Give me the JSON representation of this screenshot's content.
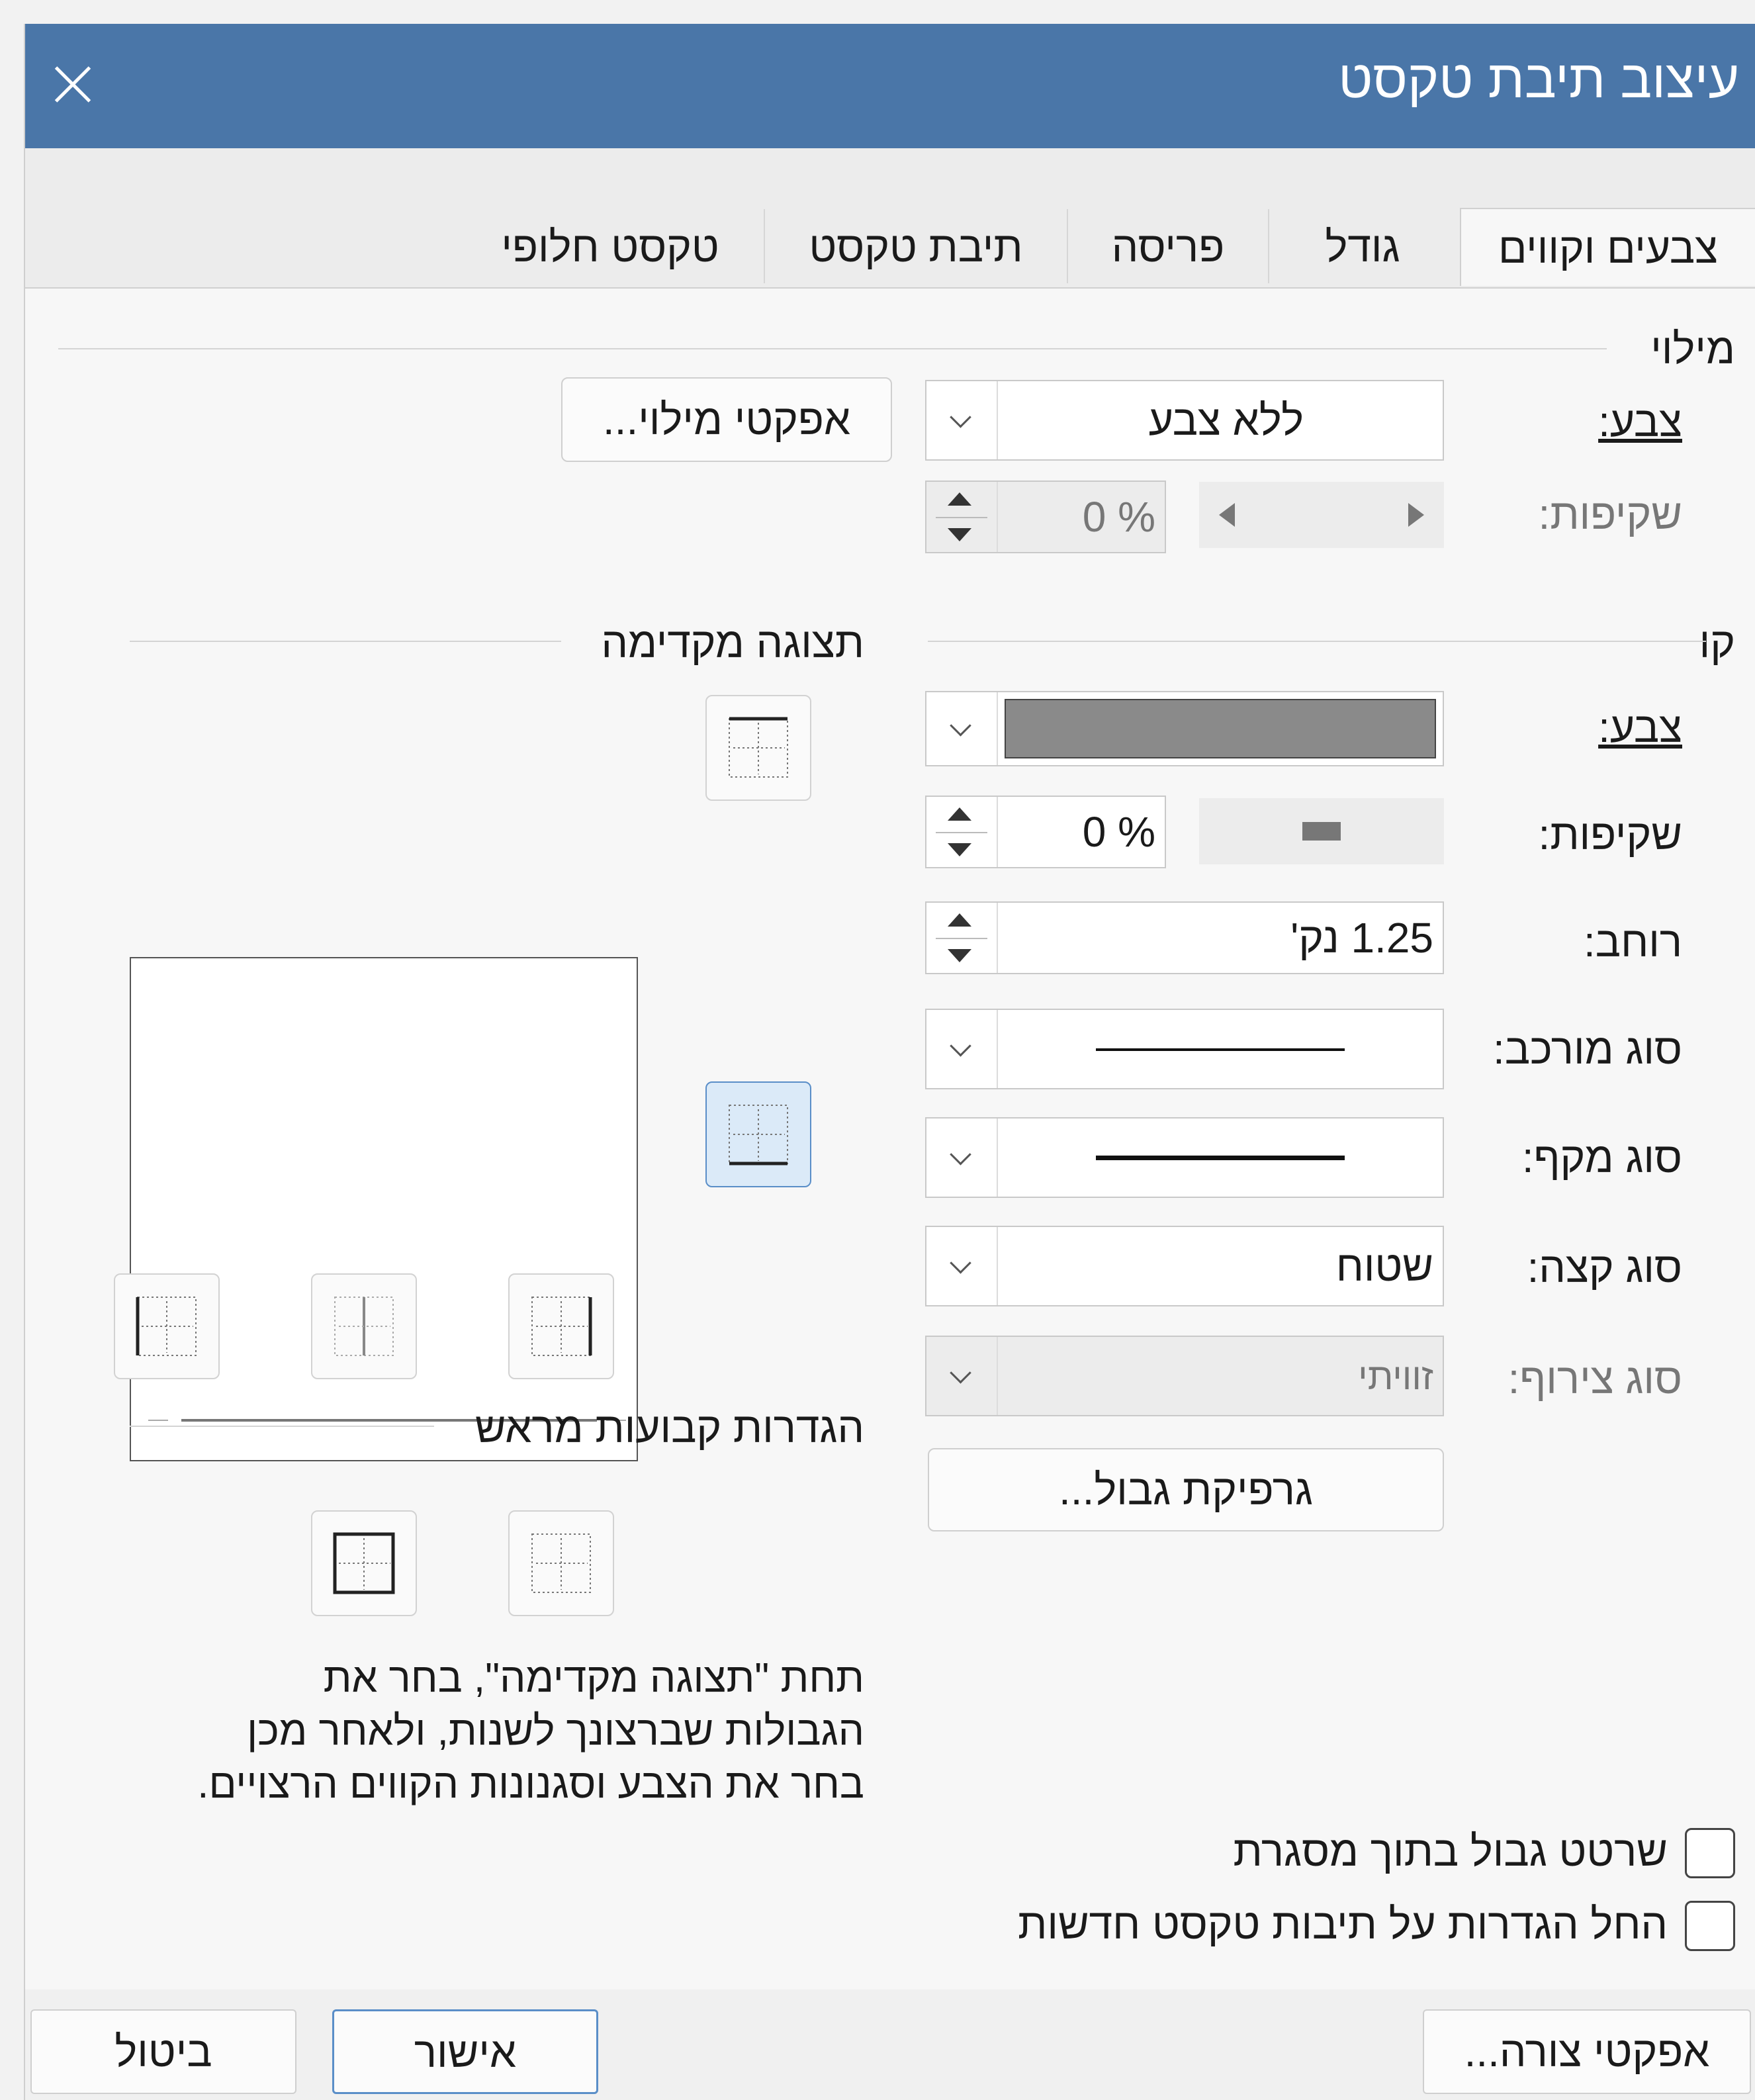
{
  "window": {
    "title": "עיצוב תיבת טקסט"
  },
  "tabs": [
    {
      "label": "צבעים וקווים",
      "active": true
    },
    {
      "label": "גודל",
      "active": false
    },
    {
      "label": "פריסה",
      "active": false
    },
    {
      "label": "תיבת טקסט",
      "active": false
    },
    {
      "label": "טקסט חלופי",
      "active": false
    }
  ],
  "fill": {
    "section": "מילוי",
    "color_label": "צבע:",
    "color_value": "ללא צבע",
    "effects_button": "אפקטי מילוי...",
    "transparency_label": "שקיפות:",
    "transparency_value": "% 0"
  },
  "line": {
    "section": "קו",
    "color_label": "צבע:",
    "color_swatch": "#8a8a8a",
    "transparency_label": "שקיפות:",
    "transparency_value": "% 0",
    "width_label": "רוחב:",
    "width_value": "1.25 נק'",
    "compound_label": "סוג מורכב:",
    "dash_label": "סוג מקף:",
    "cap_label": "סוג קצה:",
    "cap_value": "שטוח",
    "join_label": "סוג צירוף:",
    "join_value": "זוויתי",
    "border_art_button": "גרפיקת גבול..."
  },
  "preview": {
    "section": "תצוגה מקדימה"
  },
  "presets": {
    "section": "הגדרות קבועות מראש"
  },
  "help_text": [
    "תחת \"תצוגה מקדימה\", בחר את",
    "הגבולות שברצונך לשנות, ולאחר מכן",
    "בחר את הצבע וסגנונות הקווים הרצויים."
  ],
  "checkboxes": {
    "draw_border_inside": "שרטט גבול בתוך מסגרת",
    "apply_new_textboxes": "החל הגדרות על תיבות טקסט חדשות"
  },
  "footer": {
    "shape_effects": "אפקטי צורה...",
    "ok": "אישור",
    "cancel": "ביטול"
  },
  "colors": {
    "titlebar": "#4a76a8",
    "selected_border": "#5a8ec8"
  }
}
